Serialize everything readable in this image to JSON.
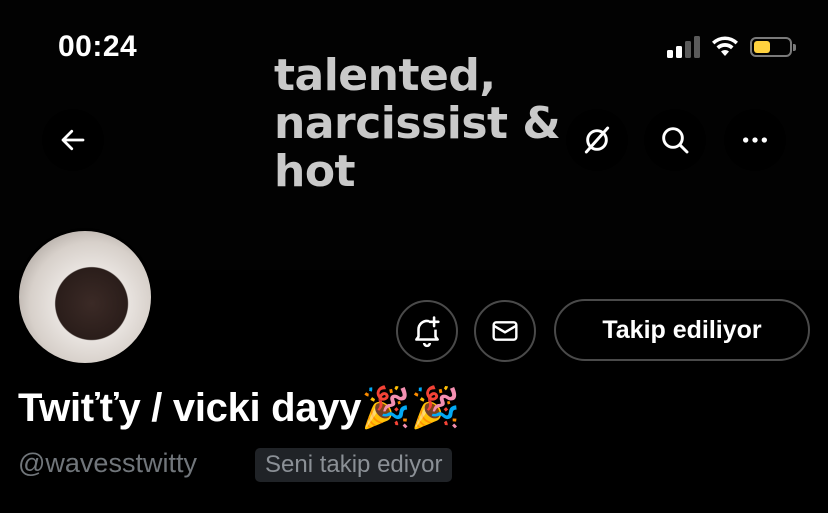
{
  "status_bar": {
    "time": "00:24",
    "battery_color": "#ffd23f"
  },
  "banner": {
    "text": "talented,\nnarcissist &\nhot"
  },
  "nav": {
    "back_icon": "arrow-left-icon",
    "circle_icon": "grok-icon",
    "search_icon": "search-icon",
    "more_icon": "more-horizontal-icon"
  },
  "profile": {
    "display_name": "Twiťťy / vicki dayy🎉🎉",
    "handle": "@wavesstwitty",
    "follows_you_label": "Seni takip ediyor"
  },
  "actions": {
    "notify_icon": "bell-plus-icon",
    "message_icon": "envelope-icon",
    "following_label": "Takip ediliyor"
  }
}
